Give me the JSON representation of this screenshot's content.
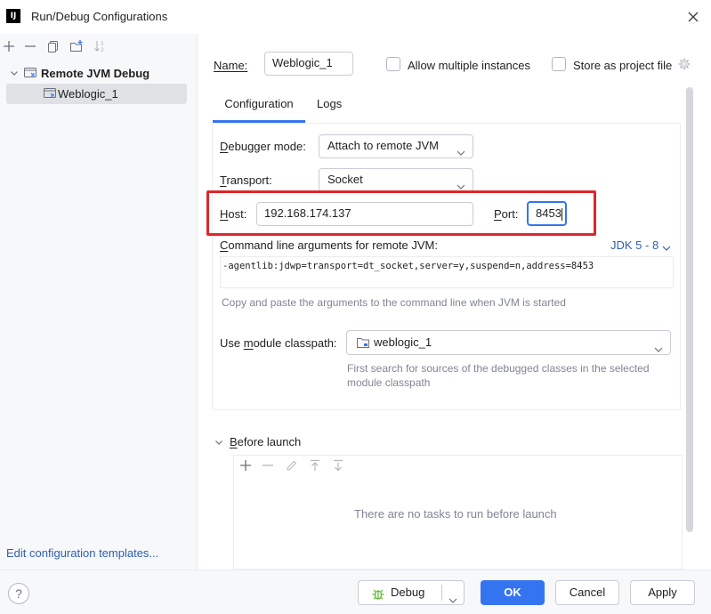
{
  "window": {
    "title": "Run/Debug Configurations",
    "app_icon_text": "IJ"
  },
  "left_toolbar": {
    "icons": [
      "add-icon",
      "remove-icon",
      "copy-icon",
      "new-folder-icon",
      "sort-icon"
    ]
  },
  "tree": {
    "group_label": "Remote JVM Debug",
    "items": [
      {
        "label": "Weblogic_1",
        "selected": true
      }
    ]
  },
  "edit_templates_link": "Edit configuration templates...",
  "name_field": {
    "label": "Name:",
    "value": "Weblogic_1"
  },
  "allow_multiple": {
    "label": "Allow multiple instances",
    "checked": false
  },
  "store_project": {
    "label": "Store as project file",
    "checked": false
  },
  "tabs": [
    {
      "label": "Configuration",
      "active": true
    },
    {
      "label": "Logs",
      "active": false
    }
  ],
  "debugger_mode": {
    "label": "Debugger mode:",
    "value": "Attach to remote JVM"
  },
  "transport": {
    "label": "Transport:",
    "value": "Socket"
  },
  "host": {
    "label": "Host:",
    "value": "192.168.174.137"
  },
  "port": {
    "label": "Port:",
    "value": "8453"
  },
  "command_line": {
    "label": "Command line arguments for remote JVM:",
    "jdk_selector": "JDK 5 - 8",
    "value": "-agentlib:jdwp=transport=dt_socket,server=y,suspend=n,address=8453",
    "hint": "Copy and paste the arguments to the command line when JVM is started"
  },
  "module_classpath": {
    "label": "Use module classpath:",
    "value": "weblogic_1",
    "hint_line1": "First search for sources of the debugged classes in the selected",
    "hint_line2": "module classpath"
  },
  "before_launch": {
    "label": "Before launch",
    "empty_text": "There are no tasks to run before launch",
    "toolbar_icons": [
      "add-icon",
      "remove-icon",
      "edit-icon",
      "move-up-icon",
      "move-down-icon"
    ]
  },
  "buttons": {
    "debug": "Debug",
    "ok": "OK",
    "cancel": "Cancel",
    "apply": "Apply",
    "help": "?"
  },
  "colors": {
    "accent": "#3574f0",
    "highlight_box": "#e0262a",
    "link": "#2e5fb4"
  }
}
